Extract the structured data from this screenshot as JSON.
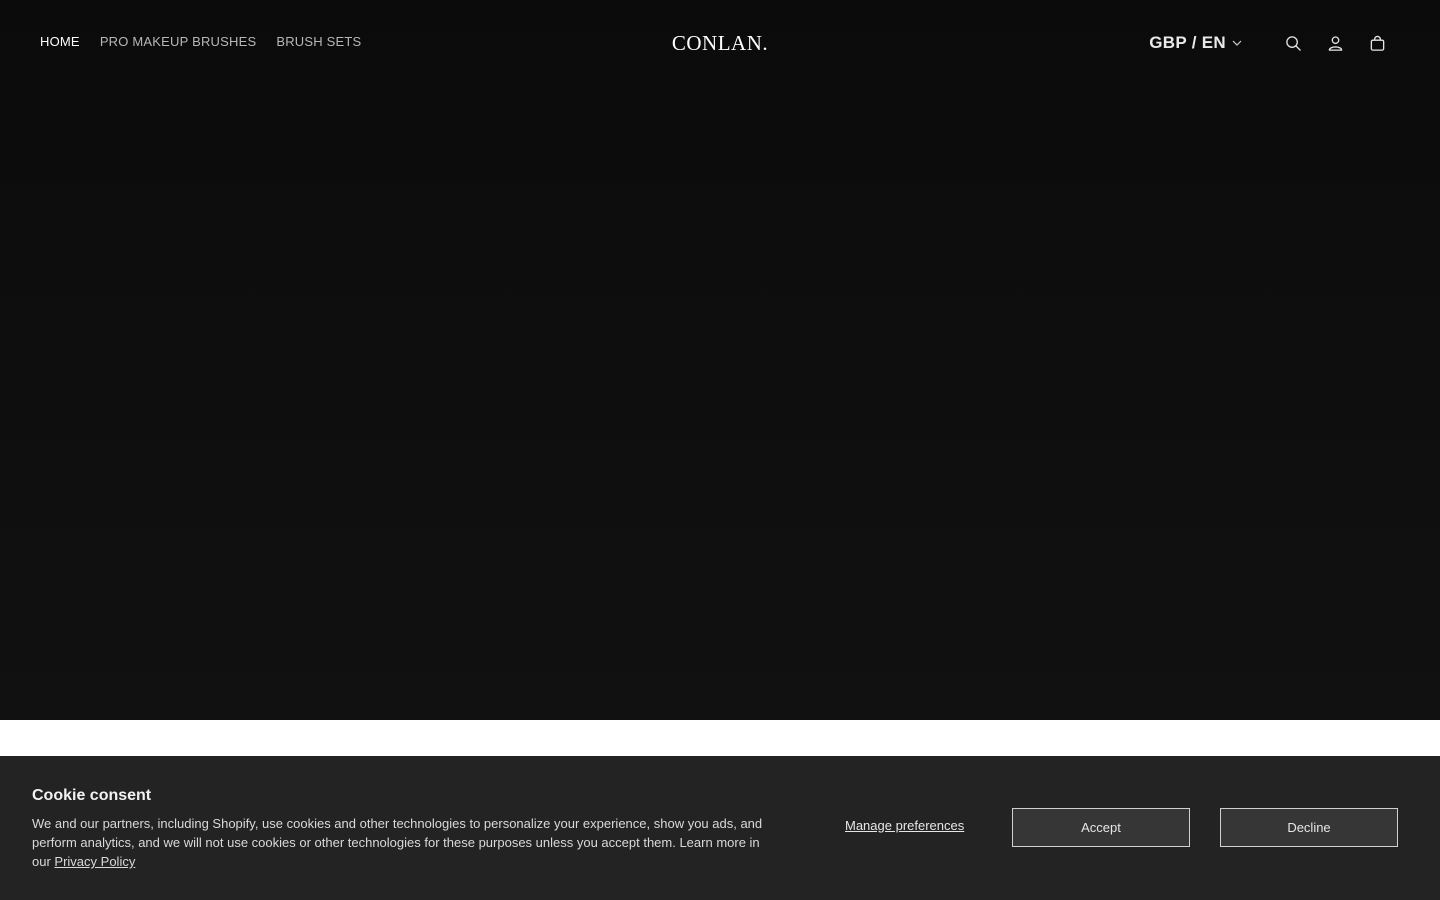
{
  "nav": {
    "items": [
      {
        "label": "HOME",
        "active": true
      },
      {
        "label": "PRO MAKEUP BRUSHES",
        "active": false
      },
      {
        "label": "BRUSH SETS",
        "active": false
      }
    ]
  },
  "brand": {
    "logo_text": "CONLAN."
  },
  "header_tools": {
    "currency_label": "GBP / EN",
    "icons": [
      "search-icon",
      "account-icon",
      "cart-icon"
    ]
  },
  "cookie": {
    "title": "Cookie consent",
    "body": "We and our partners, including Shopify, use cookies and other technologies to personalize your experience, show you ads, and perform analytics, and we will not use cookies or other technologies for these purposes unless you accept them. Learn more in our",
    "privacy_link": "Privacy Policy",
    "manage_label": "Manage preferences",
    "accept_label": "Accept",
    "decline_label": "Decline"
  },
  "colors": {
    "hero_bg": "#0f0f0f",
    "banner_bg": "#232323",
    "button_bg": "#363636"
  }
}
